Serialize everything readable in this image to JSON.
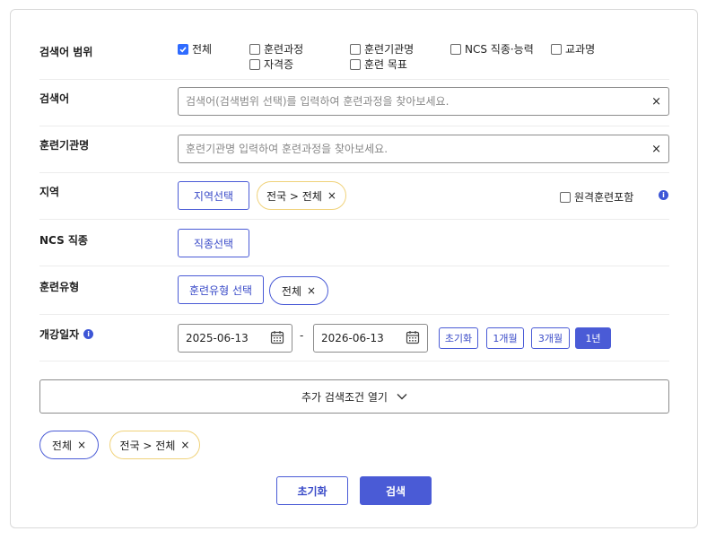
{
  "scope": {
    "label": "검색어 범위",
    "options": [
      {
        "label": "전체",
        "checked": true
      },
      {
        "label": "훈련과정",
        "checked": false
      },
      {
        "label": "훈련기관명",
        "checked": false
      },
      {
        "label": "NCS 직종·능력",
        "checked": false
      },
      {
        "label": "교과명",
        "checked": false
      },
      {
        "label": "자격증",
        "checked": false
      },
      {
        "label": "훈련 목표",
        "checked": false
      }
    ]
  },
  "keyword": {
    "label": "검색어",
    "placeholder": "검색어(검색범위 선택)를 입력하여 훈련과정을 찾아보세요.",
    "clear": "×"
  },
  "institution": {
    "label": "훈련기관명",
    "placeholder": "훈련기관명 입력하여 훈련과정을 찾아보세요.",
    "clear": "×"
  },
  "region": {
    "label": "지역",
    "button": "지역선택",
    "chip": "전국 > 전체",
    "remote_label": "원격훈련포함",
    "remote_checked": false
  },
  "ncs": {
    "label": "NCS 직종",
    "button": "직종선택"
  },
  "training_type": {
    "label": "훈련유형",
    "button": "훈련유형 선택",
    "chip": "전체"
  },
  "start_date": {
    "label": "개강일자",
    "from": "2025-06-13",
    "separator": "-",
    "to": "2026-06-13",
    "buttons": [
      {
        "label": "초기화",
        "active": false
      },
      {
        "label": "1개월",
        "active": false
      },
      {
        "label": "3개월",
        "active": false
      },
      {
        "label": "1년",
        "active": true
      }
    ]
  },
  "expand": {
    "label": "추가 검색조건 열기"
  },
  "selected_chips": [
    {
      "label": "전체",
      "color": "blue"
    },
    {
      "label": "전국 > 전체",
      "color": "yellow"
    }
  ],
  "chip_remove": "×",
  "actions": {
    "reset": "초기화",
    "search": "검색"
  },
  "info_glyph": "i",
  "colors": {
    "accent": "#4a5bd6",
    "chip_yellow_border": "#f0d27a",
    "checkbox_checked": "#2f6bff"
  }
}
